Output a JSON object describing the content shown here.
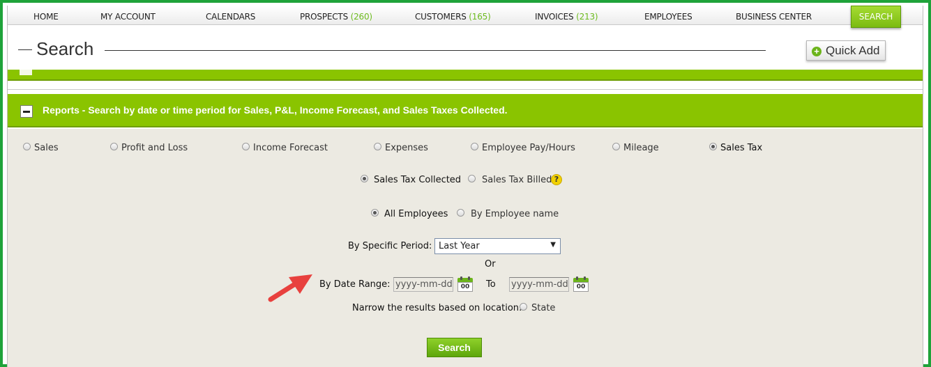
{
  "nav": {
    "items": [
      {
        "label": "HOME",
        "count": ""
      },
      {
        "label": "MY ACCOUNT",
        "count": ""
      },
      {
        "label": "CALENDARS",
        "count": ""
      },
      {
        "label": "PROSPECTS",
        "count": "(260)"
      },
      {
        "label": "CUSTOMERS",
        "count": "(165)"
      },
      {
        "label": "INVOICES",
        "count": "(213)"
      },
      {
        "label": "EMPLOYEES",
        "count": ""
      },
      {
        "label": "BUSINESS CENTER",
        "count": ""
      }
    ],
    "active": "SEARCH"
  },
  "header": {
    "title": "Search",
    "quick_add": "Quick Add"
  },
  "reports": {
    "title": "Reports - Search by date or time period for Sales, P&L, Income Forecast, and Sales Taxes Collected.",
    "report_types": [
      {
        "label": "Sales",
        "selected": false
      },
      {
        "label": "Profit and Loss",
        "selected": false
      },
      {
        "label": "Income Forecast",
        "selected": false
      },
      {
        "label": "Expenses",
        "selected": false
      },
      {
        "label": "Employee Pay/Hours",
        "selected": false
      },
      {
        "label": "Mileage",
        "selected": false
      },
      {
        "label": "Sales Tax",
        "selected": true
      }
    ],
    "tax_options": [
      {
        "label": "Sales Tax Collected",
        "selected": true
      },
      {
        "label": "Sales Tax Billed",
        "selected": false
      }
    ],
    "help_icon": "?",
    "employee_options": [
      {
        "label": "All Employees",
        "selected": true
      },
      {
        "label": "By Employee name",
        "selected": false
      }
    ],
    "period_label": "By Specific Period:",
    "period_value": "Last Year",
    "or_text": "Or",
    "date_range_label": "By Date Range:",
    "date_placeholder": "yyyy-mm-dd",
    "to_label": "To",
    "calendar_day": "00",
    "location_label": "Narrow the results based on location:",
    "location_option": "State",
    "search_button": "Search"
  },
  "colors": {
    "frame": "#1fa33a",
    "accent_green": "#8ac400",
    "panel_bg": "#eceae2",
    "arrow_red": "#e8413e",
    "nav_count": "#6dbb1f"
  }
}
